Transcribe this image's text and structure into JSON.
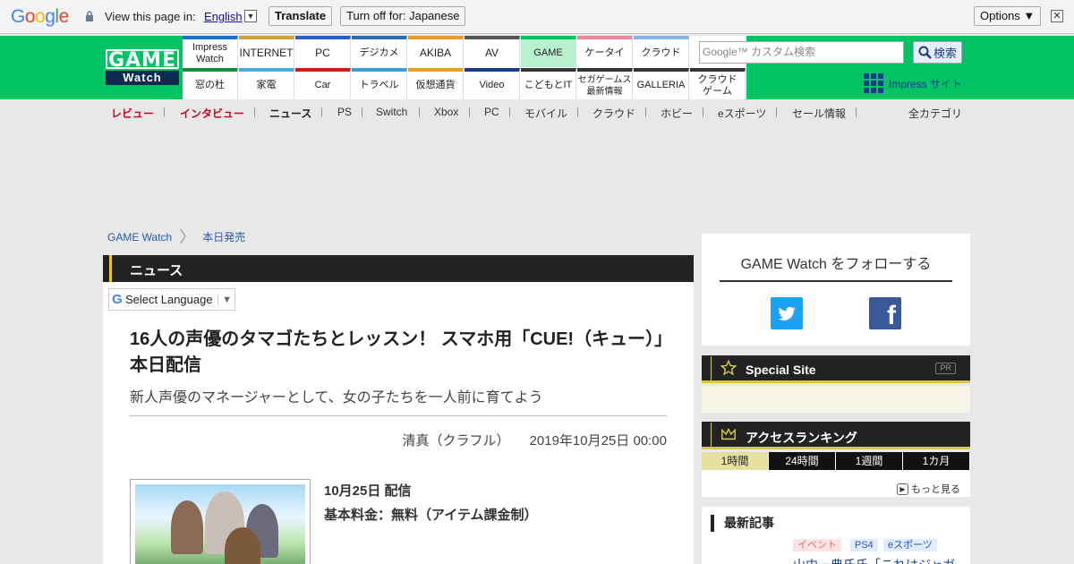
{
  "translate_bar": {
    "logo": "Google",
    "prompt": "View this page in:",
    "language": "English",
    "translate": "Translate",
    "turn_off": "Turn off for: Japanese",
    "options": "Options ▼",
    "close": "✕"
  },
  "header": {
    "logo_top": "GAME",
    "logo_bottom": "Watch",
    "sites_row1": [
      "Impress Watch",
      "INTERNET",
      "PC",
      "デジカメ",
      "AKIBA",
      "AV",
      "GAME",
      "ケータイ",
      "クラウド"
    ],
    "sites_row2": [
      "窓の杜",
      "家電",
      "Car",
      "トラベル",
      "仮想通貨",
      "Video",
      "こどもとIT",
      "セガゲームス 最新情報",
      "GALLERIA",
      "クラウド ゲーム"
    ],
    "search_placeholder": "Google™ カスタム検索",
    "search_button": "検索",
    "impress_link": "Impress サイト"
  },
  "category_nav": {
    "items": [
      "レビュー",
      "インタビュー",
      "ニュース",
      "PS",
      "Switch",
      "Xbox",
      "PC",
      "モバイル",
      "クラウド",
      "ホビー",
      "eスポーツ",
      "セール情報"
    ],
    "all": "全カテゴリ"
  },
  "breadcrumb": [
    "GAME Watch",
    "本日発売"
  ],
  "article": {
    "section": "ニュース",
    "select_language": "Select Language",
    "title": "16人の声優のタマゴたちとレッスン！ スマホ用「CUE!（キュー）」本日配信",
    "subtitle": "新人声優のマネージャーとして、女の子たちを一人前に育てよう",
    "author": "清真（クラフル）",
    "date": "2019年10月25日 00:00",
    "release_line1": "10月25日 配信",
    "release_line2": "基本料金：無料（アイテム課金制）"
  },
  "sidebar": {
    "follow_title": "GAME Watch をフォローする",
    "special_site": "Special Site",
    "pr": "PR",
    "ranking_title": "アクセスランキング",
    "ranking_tabs": [
      "1時間",
      "24時間",
      "1週間",
      "1カ月"
    ],
    "more": "もっと見る",
    "latest_title": "最新記事",
    "latest_tags": [
      "イベント",
      "PS4",
      "eスポーツ"
    ],
    "latest_article": "山内一典氏氏「これはジャガ"
  },
  "colors": {
    "header_green": "#00c464",
    "accent_yellow": "#d6c84a",
    "link_blue": "#1a3c88"
  }
}
